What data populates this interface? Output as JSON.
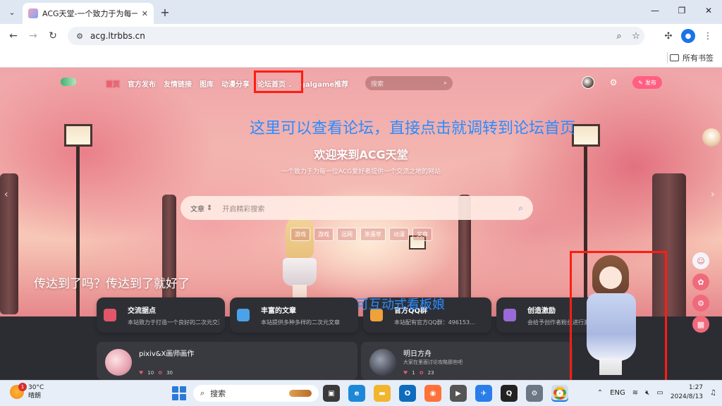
{
  "browser": {
    "tab_title": "ACG天堂-一个致力于为每一位ACG爱好者提供一个交流之地的网站",
    "url": "acg.ltrbbs.cn",
    "bookmarks_label": "所有书签"
  },
  "site": {
    "nav": [
      "首页",
      "官方发布",
      "友情链接",
      "图库",
      "动漫分享",
      "论坛首页",
      "galgame推荐"
    ],
    "nav_active": "首页",
    "nav_dropdown_item": "论坛首页",
    "search_placeholder": "搜索",
    "publish_label": "发布",
    "welcome_title": "欢迎来到ACG天堂",
    "welcome_sub": "一个致力于为每一位ACG爱好者提供一个交流之地的网站",
    "search_type": "文章",
    "search_box_placeholder": "开启精彩搜索",
    "tags": [
      "游戏",
      "游戏",
      "逗网",
      "笨蛋草",
      "动漫",
      "文章"
    ],
    "slogan": "传达到了吗？传达到了就好了",
    "features": [
      {
        "title": "交流据点",
        "desc": "本站致力于打造一个良好的二次元交流平台",
        "color": "#e2566a"
      },
      {
        "title": "丰富的文章",
        "desc": "本站提供多种多样的二次元文章",
        "color": "#4aa3e8"
      },
      {
        "title": "官方QQ群",
        "desc": "本站配有官方QQ群：496153...",
        "color": "#f0a23a"
      },
      {
        "title": "创造激励",
        "desc": "会给予创作者粉丝进行激励",
        "color": "#9a6ad8"
      }
    ],
    "posts": [
      {
        "title": "pixiv&X画师画作",
        "desc": "",
        "likes": "10",
        "views": "30"
      },
      {
        "title": "明日方舟",
        "desc": "大家在里面讨论攻略那些吧",
        "likes": "1",
        "views": "23"
      }
    ]
  },
  "annotations": {
    "top": "这里可以查看论坛，直接点击就调转到论坛首页",
    "mascot": "可互动式看板娘"
  },
  "taskbar": {
    "temperature": "30°C",
    "weather": "晴朗",
    "weather_badge": "1",
    "search_label": "搜索",
    "language": "ENG",
    "time": "1:27",
    "date": "2024/8/13"
  }
}
